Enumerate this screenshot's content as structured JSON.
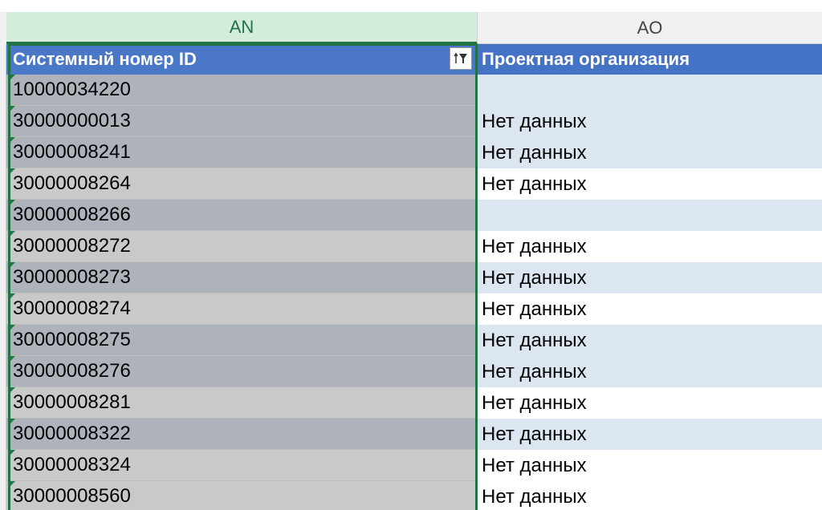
{
  "columns": {
    "an": "AN",
    "ao": "AO"
  },
  "header": {
    "col_an": "Системный номер ID",
    "col_ao": "Проектная организация",
    "filter_icon": "filter-sort-icon"
  },
  "rows": [
    {
      "id": "10000034220",
      "org": ""
    },
    {
      "id": "30000000013",
      "org": "Нет данных"
    },
    {
      "id": "30000008241",
      "org": "Нет данных"
    },
    {
      "id": "30000008264",
      "org": "Нет данных"
    },
    {
      "id": "30000008266",
      "org": ""
    },
    {
      "id": "30000008272",
      "org": "Нет данных"
    },
    {
      "id": "30000008273",
      "org": "Нет данных"
    },
    {
      "id": "30000008274",
      "org": "Нет данных"
    },
    {
      "id": "30000008275",
      "org": "Нет данных"
    },
    {
      "id": "30000008276",
      "org": "Нет данных"
    },
    {
      "id": "30000008281",
      "org": "Нет данных"
    },
    {
      "id": "30000008322",
      "org": "Нет данных"
    },
    {
      "id": "30000008324",
      "org": "Нет данных"
    },
    {
      "id": "30000008560",
      "org": "Нет данных"
    }
  ],
  "colors": {
    "selection": "#217346",
    "header_fill": "#4472c4",
    "band_blue": "#dce6f1"
  }
}
